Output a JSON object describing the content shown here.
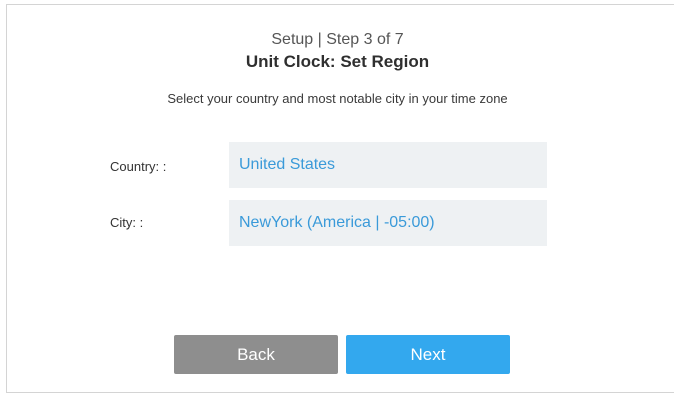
{
  "header": {
    "step": "Setup | Step 3 of 7",
    "title": "Unit Clock: Set Region",
    "subtitle": "Select your country and most notable city in your time zone"
  },
  "form": {
    "country": {
      "label": "Country: :",
      "value": "United States"
    },
    "city": {
      "label": "City: :",
      "value": "NewYork (America | -05:00)"
    }
  },
  "buttons": {
    "back_label": "Back",
    "next_label": "Next"
  },
  "colors": {
    "accent": "#33a8ee",
    "field_text": "#3a9ad9",
    "field_bg": "#eef1f3",
    "back_button": "#8e8e8e"
  }
}
